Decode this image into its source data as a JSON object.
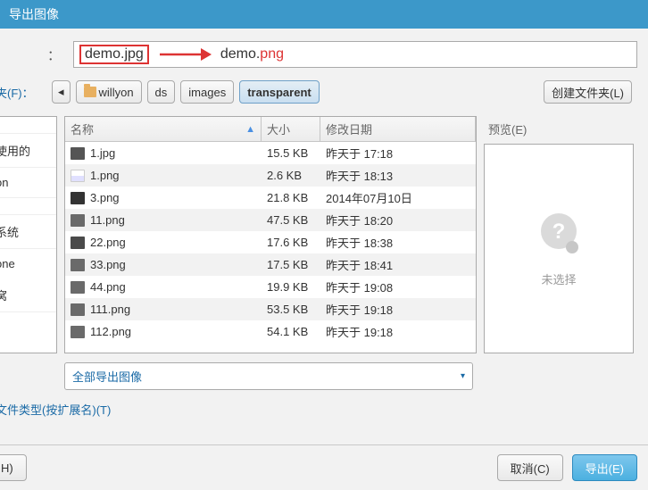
{
  "title": "导出图像",
  "filename_colon": "：",
  "filename_original": "demo.jpg",
  "filename_example_prefix": "demo.",
  "filename_example_ext": "png",
  "save_in_label": "件夹(F)：",
  "path_segments": [
    "◂",
    "willyon",
    "ds",
    "images",
    "transparent"
  ],
  "create_folder_label": "创建文件夹(L)",
  "sidebar": [
    " ",
    "使用的",
    "on",
    " ",
    "系统",
    "one",
    "窝"
  ],
  "columns": {
    "name": "名称",
    "size": "大小",
    "date": "修改日期"
  },
  "sort_indicator": "▲",
  "files": [
    {
      "name": "1.jpg",
      "size": "15.5 KB",
      "date": "昨天于 17:18"
    },
    {
      "name": "1.png",
      "size": "2.6 KB",
      "date": "昨天于 18:13"
    },
    {
      "name": "3.png",
      "size": "21.8 KB",
      "date": "2014年07月10日"
    },
    {
      "name": "11.png",
      "size": "47.5 KB",
      "date": "昨天于 18:20"
    },
    {
      "name": "22.png",
      "size": "17.6 KB",
      "date": "昨天于 18:38"
    },
    {
      "name": "33.png",
      "size": "17.5 KB",
      "date": "昨天于 18:41"
    },
    {
      "name": "44.png",
      "size": "19.9 KB",
      "date": "昨天于 19:08"
    },
    {
      "name": "111.png",
      "size": "53.5 KB",
      "date": "昨天于 19:18"
    },
    {
      "name": "112.png",
      "size": "54.1 KB",
      "date": "昨天于 19:18"
    }
  ],
  "preview_title": "预览(E)",
  "preview_empty": "未选择",
  "dropdown_label": "全部导出图像",
  "dropdown_arrow": "▾",
  "disclosure_label": "文件类型(按扩展名)(T)",
  "disclosure_arrow": "▸",
  "help_label": "H)",
  "cancel_label": "取消(C)",
  "export_label": "导出(E)"
}
